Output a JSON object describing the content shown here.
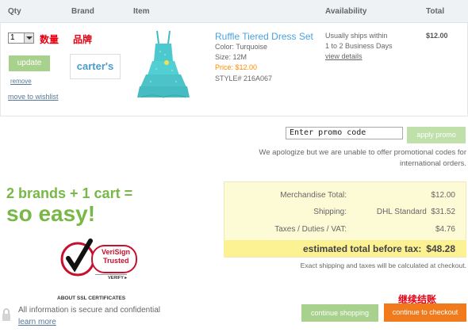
{
  "columns": {
    "qty": "Qty",
    "brand": "Brand",
    "item": "Item",
    "availability": "Availability",
    "total": "Total"
  },
  "cart_item": {
    "qty_value": "1",
    "qty_cn": "数量",
    "brand_cn": "品牌",
    "update_label": "update",
    "remove_label": "remove",
    "wishlist_label": "move to wishlist",
    "brand_name": "carter's",
    "title": "Ruffle Tiered Dress Set",
    "color": "Color: Turquoise",
    "size": "Size: 12M",
    "price": "Price: $12.00",
    "style": "STYLE# 216A067",
    "availability_line1": "Usually ships within",
    "availability_line2": "1 to 2 Business Days",
    "view_details": "view details",
    "total": "$12.00"
  },
  "promo": {
    "input_value": "Enter promo code",
    "button_label": "apply promo",
    "message_line1": "We apologize but we are unable to offer promotional codes for",
    "message_line2": "international orders."
  },
  "marketing": {
    "slogan_line1": "2 brands + 1 cart =",
    "slogan_line2": "so easy!",
    "verisign_line1": "VeriSign",
    "verisign_line2": "Trusted",
    "verisign_verify": "VERIFY ▸",
    "about_ssl": "ABOUT SSL CERTIFICATES",
    "secure_text": "All information is secure and confidential",
    "learn_more": "learn more"
  },
  "totals": {
    "merchandise_label": "Merchandise Total:",
    "merchandise_value": "$12.00",
    "shipping_label": "Shipping:",
    "shipping_value": "DHL Standard  $31.52",
    "taxes_label": "Taxes / Duties / VAT:",
    "taxes_value": "$4.76",
    "estimated_label": "estimated total before tax:",
    "estimated_value": "$48.28",
    "note": "Exact shipping and taxes will be calculated at checkout."
  },
  "actions": {
    "checkout_cn": "继续结账",
    "continue_shopping": "continue shopping",
    "continue_checkout": "continue to checkout"
  },
  "colors": {
    "accent_green": "#78b847",
    "checkout_orange": "#f07a1c",
    "link_blue": "#4aa3df",
    "price_orange": "#ff8a00",
    "chinese_red": "#e60012"
  }
}
